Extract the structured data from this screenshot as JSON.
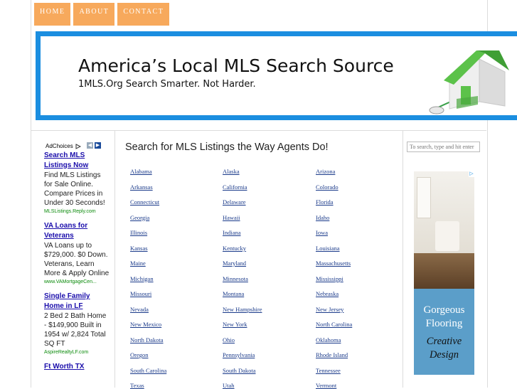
{
  "nav": {
    "items": [
      "HOME",
      "ABOUT",
      "CONTACT"
    ]
  },
  "banner": {
    "title": "America’s Local MLS Search Source",
    "subtitle": "1MLS.Org Search Smarter. Not Harder."
  },
  "ads": {
    "adchoices_label": "AdChoices",
    "items": [
      {
        "title": "Search MLS Listings Now",
        "body": "Find MLS Listings for Sale Online. Compare Prices in Under 30 Seconds!",
        "url": "MLSListings.Reply.com"
      },
      {
        "title": "VA Loans for Veterans",
        "body": "VA Loans up to $729,000. $0 Down. Veterans, Learn More & Apply Online",
        "url": "www.VAMortgageCen..."
      },
      {
        "title": "Single Family Home in LF",
        "body": "2 Bed 2 Bath Home - $149,900 Built in 1954 w/ 2,824 Total SQ FT",
        "url": "AspireRealtyLF.com"
      },
      {
        "title": "Ft Worth TX",
        "body": "",
        "url": ""
      }
    ]
  },
  "main": {
    "heading": "Search for MLS Listings the Way Agents Do!",
    "states": [
      [
        "Alabama",
        "Alaska",
        "Arizona"
      ],
      [
        "Arkansas",
        "California",
        "Colorado"
      ],
      [
        "Connecticut",
        "Delaware",
        "Florida"
      ],
      [
        "Georgia",
        "Hawaii",
        "Idaho"
      ],
      [
        "Illinois",
        "Indiana",
        "Iowa"
      ],
      [
        "Kansas",
        "Kentucky",
        "Louisiana"
      ],
      [
        "Maine",
        "Maryland",
        "Massachusetts"
      ],
      [
        "Michigan",
        "Minnesota",
        "Mississippi"
      ],
      [
        "Missouri",
        "Montana",
        "Nebraska"
      ],
      [
        "Nevada",
        "New Hampshire",
        "New Jersey"
      ],
      [
        "New Mexico",
        "New York",
        "North Carolina"
      ],
      [
        "North Dakota",
        "Ohio",
        "Oklahoma"
      ],
      [
        "Oregon",
        "Pennsylvania",
        "Rhode Island"
      ],
      [
        "South Carolina",
        "South Dakota",
        "Tennessee"
      ],
      [
        "Texas",
        "Utah",
        "Vermont"
      ]
    ]
  },
  "sidebar": {
    "search_placeholder": "To search, type and hit enter",
    "ad_headline": "Gorgeous Flooring",
    "ad_tagline": "Creative Design"
  },
  "colors": {
    "nav": "#f7a95c",
    "banner_border": "#1b8ee0",
    "link": "#1a3a8a",
    "ad_link": "#1a0dab",
    "ad_url": "#0a8a0a"
  }
}
